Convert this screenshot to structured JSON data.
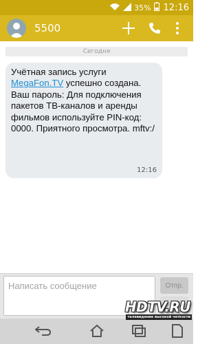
{
  "status_bar": {
    "battery_text": "35%",
    "time": "12:16",
    "icons": [
      "wifi-icon",
      "signal-icon",
      "battery-icon"
    ]
  },
  "title_bar": {
    "contact_name": "5500",
    "avatar_icon": "person-icon",
    "actions": [
      "add-icon",
      "phone-icon",
      "overflow-menu-icon"
    ]
  },
  "thread": {
    "date_divider": "Сегодня",
    "message": {
      "text_part1": "Учётная запись услуги ",
      "link_text": "MegaFon.TV",
      "text_part2": " успешно создана. Ваш пароль:                  Для подключения пакетов ТВ-каналов и аренды фильмов используйте PIN-код: 0000. Приятного просмотра. mftv:/",
      "time": "12:16"
    }
  },
  "compose": {
    "placeholder": "Написать сообщение",
    "send_label": "Отпр.",
    "attach_icon": "paperclip-icon"
  },
  "nav_bar": {
    "buttons": [
      "back-icon",
      "home-icon",
      "recents-icon",
      "sim-icon"
    ]
  },
  "watermark": {
    "brand": "HDTV.RU",
    "tagline": "телевидение высокой четкости"
  },
  "colors": {
    "status_bar": "#c9a80d",
    "title_bar": "#d9b820",
    "bubble": "#e9ecef",
    "link": "#1e8fd6",
    "compose_bg": "#e6e6e6",
    "nav_bar": "#d4d4d4"
  }
}
